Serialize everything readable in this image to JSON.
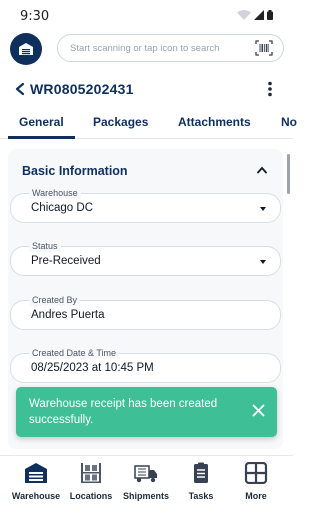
{
  "status_bar": {
    "time": "9:30"
  },
  "search": {
    "placeholder": "Start scanning or tap icon to search"
  },
  "header": {
    "title": "WR0805202431"
  },
  "tabs": [
    {
      "label": "General"
    },
    {
      "label": "Packages"
    },
    {
      "label": "Attachments"
    },
    {
      "label": "No"
    }
  ],
  "section": {
    "title": "Basic Information"
  },
  "fields": [
    {
      "label": "Warehouse",
      "value": "Chicago DC"
    },
    {
      "label": "Status",
      "value": "Pre-Received"
    },
    {
      "label": "Created By",
      "value": "Andres Puerta"
    },
    {
      "label": "Created Date & Time",
      "value": "08/25/2023 at 10:45 PM"
    }
  ],
  "toast": {
    "message": "Warehouse receipt has been created successfully."
  },
  "nav": [
    {
      "label": "Warehouse",
      "icon": "warehouse-icon"
    },
    {
      "label": "Locations",
      "icon": "locations-icon"
    },
    {
      "label": "Shipments",
      "icon": "truck-icon"
    },
    {
      "label": "Tasks",
      "icon": "tasks-icon"
    },
    {
      "label": "More",
      "icon": "grid-icon"
    }
  ],
  "colors": {
    "brand": "#0f2f5c",
    "toast": "#3ebf95"
  }
}
